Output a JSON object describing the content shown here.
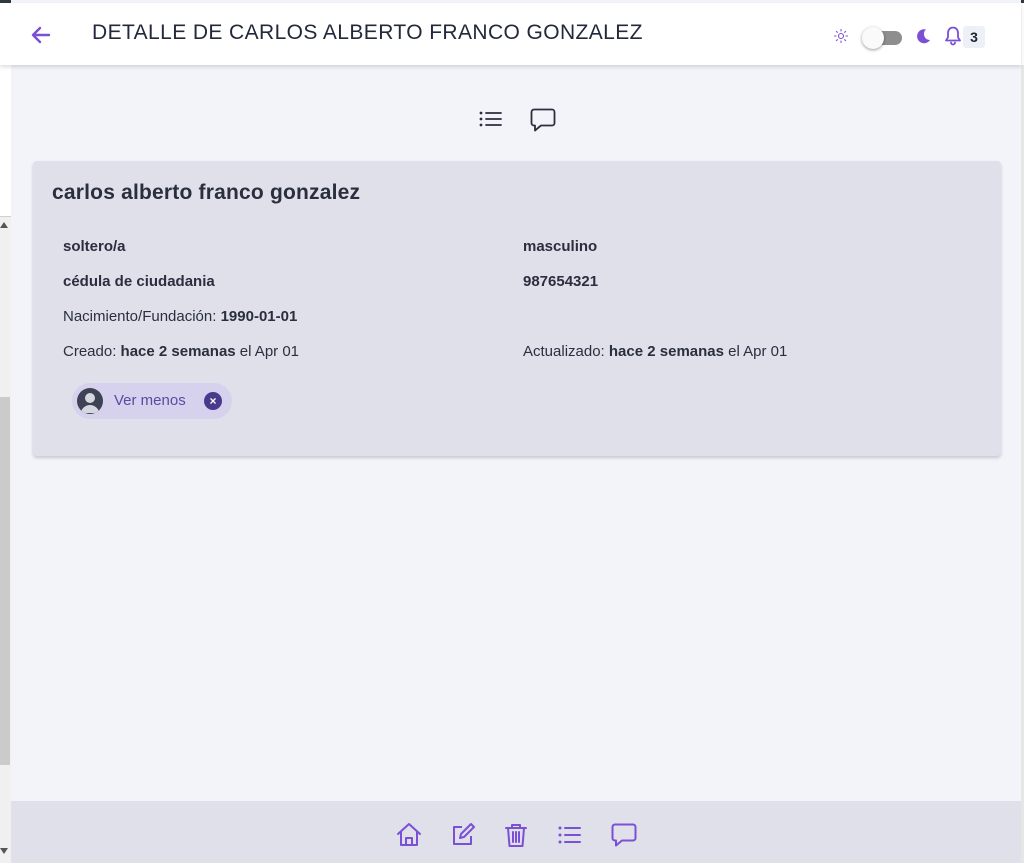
{
  "header": {
    "title": "DETALLE DE CARLOS ALBERTO FRANCO GONZALEZ",
    "notification_count": "3",
    "icons": [
      "back-arrow-icon",
      "sun-icon",
      "theme-toggle",
      "moon-icon",
      "bell-icon"
    ]
  },
  "view_switcher": {
    "icons": [
      "list-icon",
      "comment-icon"
    ]
  },
  "person": {
    "name": "carlos alberto franco gonzalez",
    "marital_status": "soltero/a",
    "gender": "masculino",
    "id_type": "cédula de ciudadania",
    "id_number": "987654321",
    "birth_label": "Nacimiento/Fundación:",
    "birth_date": "1990-01-01",
    "created_label": "Creado:",
    "created_relative": "hace 2 semanas",
    "created_date": "el Apr 01",
    "updated_label": "Actualizado:",
    "updated_relative": "hace 2 semanas",
    "updated_date": "el Apr 01"
  },
  "chip": {
    "label": "Ver menos",
    "icon": "user-avatar-icon"
  },
  "bottom_nav": {
    "icons": [
      "home-icon",
      "edit-icon",
      "trash-icon",
      "list-icon",
      "comment-icon"
    ]
  },
  "colors": {
    "accent": "#7b4fd6",
    "background": "#f3f4fa",
    "card": "#dfe0ea",
    "chip": "#d6d2ee"
  }
}
